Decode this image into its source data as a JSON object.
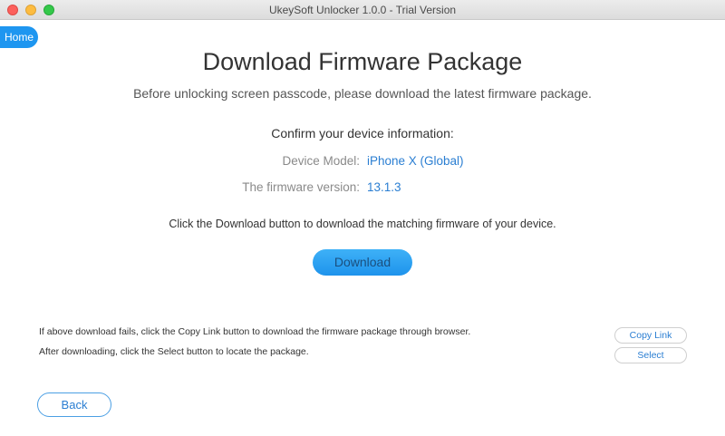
{
  "window": {
    "title": "UkeySoft Unlocker 1.0.0 - Trial Version"
  },
  "nav": {
    "home_label": "Home",
    "back_label": "Back"
  },
  "main": {
    "title": "Download Firmware Package",
    "subtitle": "Before unlocking screen passcode, please download the latest firmware package.",
    "confirm_heading": "Confirm your device information:",
    "device_model_label": "Device Model:",
    "device_model_value": "iPhone X (Global)",
    "firmware_label": "The firmware version:",
    "firmware_value": "13.1.3",
    "instruction": "Click the Download button to download the matching firmware of your device.",
    "download_label": "Download"
  },
  "footer": {
    "note_copy": "If above download fails, click the Copy Link button to download the firmware package through browser.",
    "note_select": "After downloading, click the Select button to locate the package.",
    "copy_link_label": "Copy Link",
    "select_label": "Select"
  },
  "colors": {
    "accent": "#1e96f0",
    "link": "#2a7ed2",
    "label_gray": "#8a8a8a"
  }
}
